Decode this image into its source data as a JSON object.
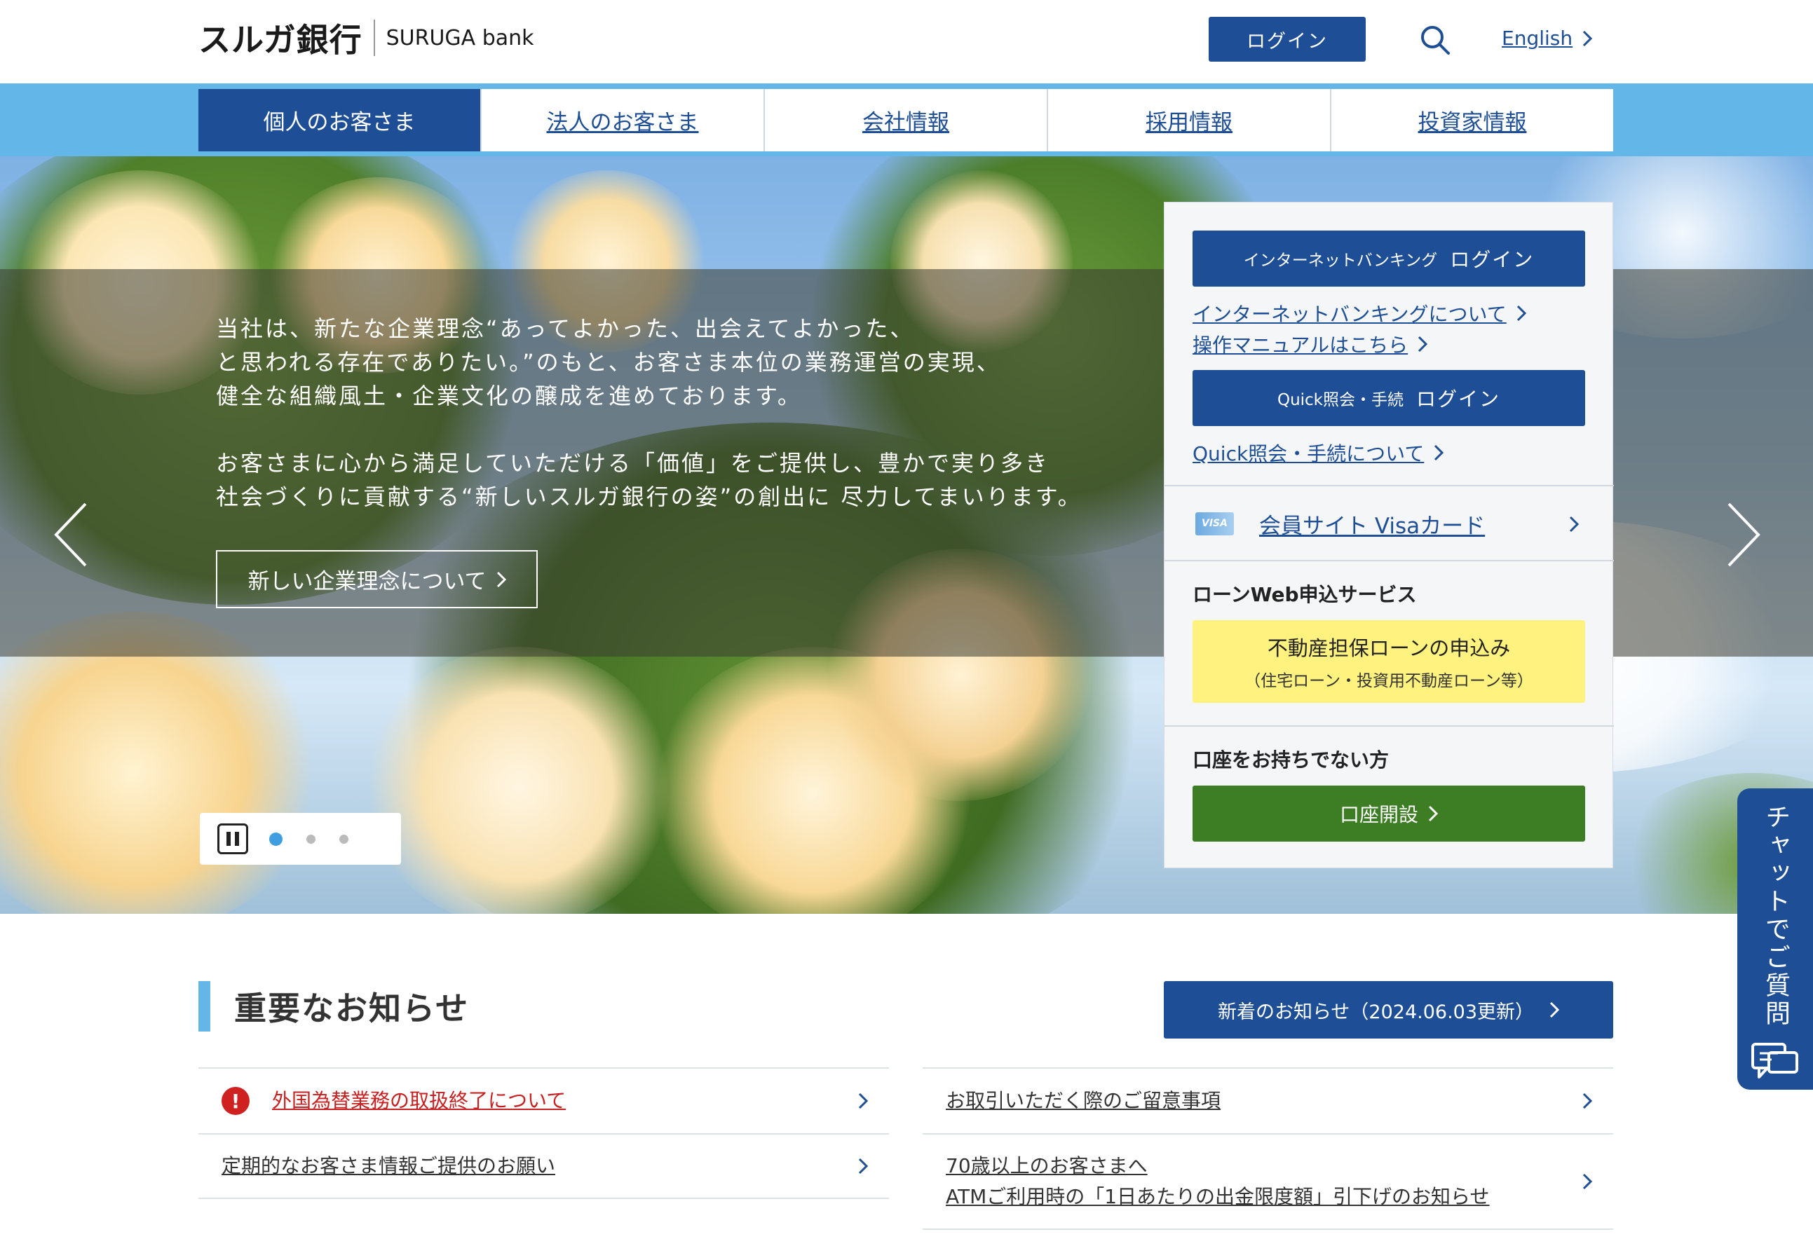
{
  "header": {
    "logo_jp": "スルガ銀行",
    "logo_en": "SURUGA bank",
    "login_label": "ログイン",
    "lang_label": "English"
  },
  "nav": {
    "items": [
      {
        "label": "個人のお客さま"
      },
      {
        "label": "法人のお客さま"
      },
      {
        "label": "会社情報"
      },
      {
        "label": "採用情報"
      },
      {
        "label": "投資家情報"
      }
    ]
  },
  "hero": {
    "para1_line1": "当社は、新たな企業理念“あってよかった、出会えてよかった、",
    "para1_line2": "と思われる存在でありたい。”のもと、お客さま本位の業務運営の実現、",
    "para1_line3": "健全な組織風土・企業文化の醸成を進めております。",
    "para2_line1": "お客さまに心から満足していただける「価値」をご提供し、豊かで実り多き",
    "para2_line2": "社会づくりに貢献する“新しいスルガ銀行の姿”の創出に 尽力してまいります。",
    "button_label": "新しい企業理念について",
    "slides_total": 3,
    "slide_active": 1
  },
  "panel": {
    "ib_login_small": "インターネットバンキング",
    "ib_login_large": "ログイン",
    "ib_about": "インターネットバンキングについて",
    "manual": "操作マニュアルはこちら",
    "quick_login_small": "Quick照会・手続",
    "quick_login_large": "ログイン",
    "quick_about": "Quick照会・手続について",
    "visa_logo": "VISA",
    "visa_label": "会員サイト Visaカード",
    "loan_heading": "ローンWeb申込サービス",
    "loan_main": "不動産担保ローンの申込み",
    "loan_sub": "（住宅ローン・投資用不動産ローン等）",
    "account_heading": "口座をお持ちでない方",
    "account_btn": "口座開設"
  },
  "chat": {
    "label": "チャットでご質問"
  },
  "news": {
    "title": "重要なお知らせ",
    "latest_btn": "新着のお知らせ（2024.06.03更新）",
    "alert_mark": "!",
    "left": [
      {
        "text": "外国為替業務の取扱終了について"
      },
      {
        "text": "定期的なお客さま情報ご提供のお願い"
      }
    ],
    "right": [
      {
        "text": "お取引いただく際のご留意事項"
      },
      {
        "line1": "70歳以上のお客さまへ",
        "line2": "ATMご利用時の「1日あたりの出金限度額」引下げのお知らせ"
      }
    ]
  },
  "colors": {
    "brand_blue": "#1e4f96",
    "nav_light_blue": "#63b6e8",
    "loan_yellow": "#fff27f",
    "open_green": "#3d7d23",
    "alert_red": "#d02121"
  }
}
